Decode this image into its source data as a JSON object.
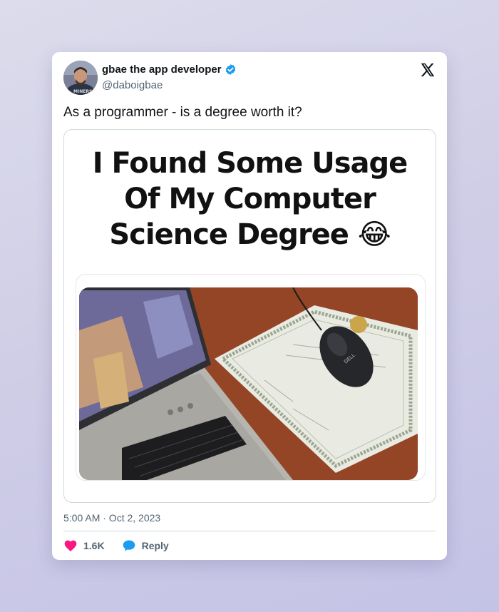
{
  "tweet": {
    "display_name": "gbae the app developer",
    "handle": "@daboigbae",
    "text": "As a programmer - is a degree worth it?",
    "meme_headline_line1": "I Found Some Usage",
    "meme_headline_line2": "Of My Computer",
    "meme_headline_line3": "Science Degree",
    "meme_emoji": "😂",
    "timestamp": "5:00 AM · Oct 2, 2023",
    "likes": "1.6K",
    "reply_label": "Reply"
  },
  "icons": {
    "verified": "verified-badge-icon",
    "brand": "x-logo-icon",
    "like": "heart-icon",
    "reply": "speech-bubble-icon"
  },
  "colors": {
    "verified": "#1d9bf0",
    "heart": "#f91880",
    "reply": "#1d9bf0"
  }
}
